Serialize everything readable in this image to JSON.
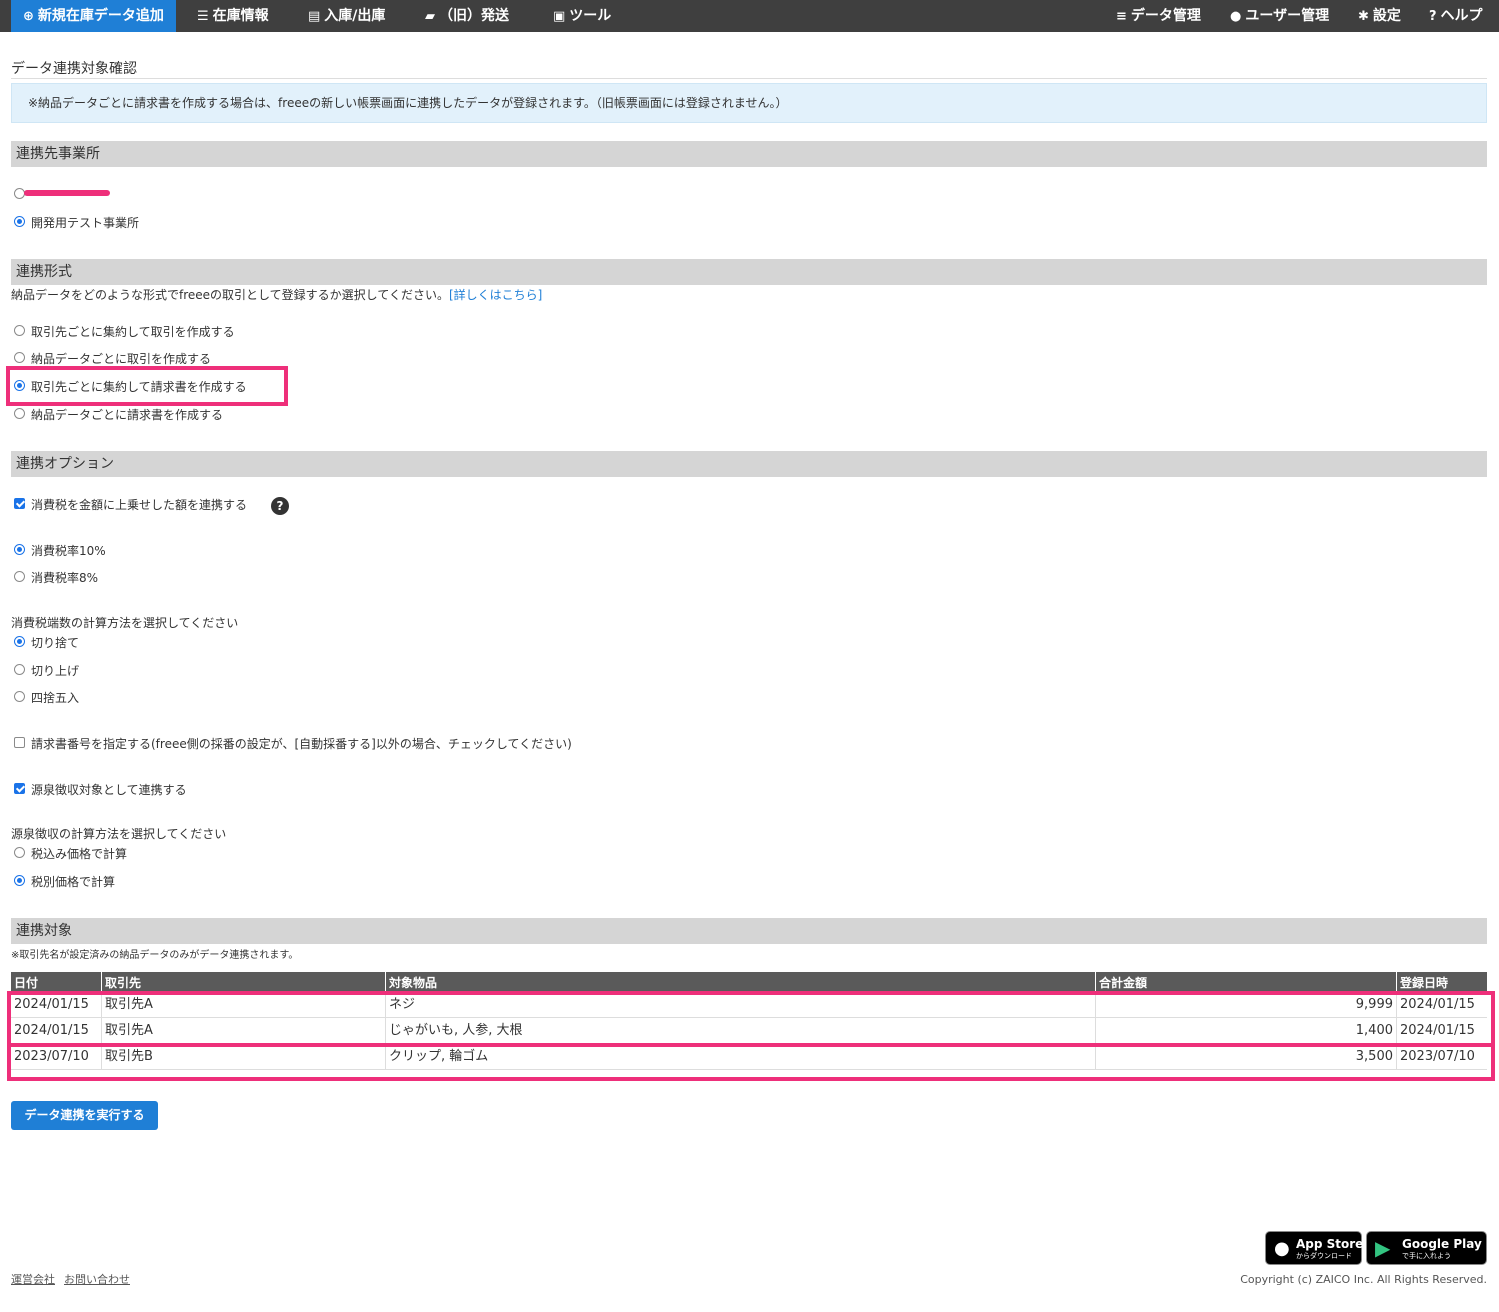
{
  "nav": {
    "primary": "新規在庫データ追加",
    "inventory": "在庫情報",
    "inout": "入庫/出庫",
    "shipping": "（旧）発送",
    "tools": "ツール",
    "data_management": "データ管理",
    "user_management": "ユーザー管理",
    "settings": "設定",
    "help": "ヘルプ"
  },
  "page": {
    "title": "データ連携対象確認",
    "notice": "※納品データごとに請求書を作成する場合は、freeeの新しい帳票画面に連携したデータが登録されます。（旧帳票画面には登録されません。）"
  },
  "office": {
    "heading": "連携先事業所",
    "options": [
      "",
      "開発用テスト事業所"
    ]
  },
  "format": {
    "heading": "連携形式",
    "description": "納品データをどのような形式でfreeeの取引として登録するか選択してください。",
    "detail_link": "[詳しくはこちら]",
    "options": [
      "取引先ごとに集約して取引を作成する",
      "納品データごとに取引を作成する",
      "取引先ごとに集約して請求書を作成する",
      "納品データごとに請求書を作成する"
    ]
  },
  "options": {
    "heading": "連携オプション",
    "tax_add": "消費税を金額に上乗せした額を連携する",
    "help_mark": "?",
    "tax_rates": [
      "消費税率10%",
      "消費税率8%"
    ],
    "rounding_label": "消費税端数の計算方法を選択してください",
    "rounding": [
      "切り捨て",
      "切り上げ",
      "四捨五入"
    ],
    "invoice_number": "請求書番号を指定する(freee側の採番の設定が、[自動採番する]以外の場合、チェックしてください)",
    "withholding": "源泉徴収対象として連携する",
    "withholding_label": "源泉徴収の計算方法を選択してください",
    "withholding_methods": [
      "税込み価格で計算",
      "税別価格で計算"
    ]
  },
  "targets": {
    "heading": "連携対象",
    "note": "※取引先名が設定済みの納品データのみがデータ連携されます。",
    "columns": [
      "日付",
      "取引先",
      "対象物品",
      "合計金額",
      "登録日時"
    ],
    "rows": [
      {
        "date": "2024/01/15",
        "partner": "取引先A",
        "items": "ネジ",
        "total": "9,999",
        "registered": "2024/01/15"
      },
      {
        "date": "2024/01/15",
        "partner": "取引先A",
        "items": "じゃがいも, 人参, 大根",
        "total": "1,400",
        "registered": "2024/01/15"
      },
      {
        "date": "2023/07/10",
        "partner": "取引先B",
        "items": "クリップ, 輪ゴム",
        "total": "3,500",
        "registered": "2023/07/10"
      }
    ]
  },
  "run_button": "データ連携を実行する",
  "footer": {
    "company": "運営会社",
    "contact": "お問い合わせ",
    "appstore": "App Store",
    "appstore_sub": "からダウンロード",
    "googleplay": "Google Play",
    "googleplay_sub": "で手に入れよう",
    "copyright": "Copyright (c) ZAICO Inc. All Rights Reserved."
  },
  "colors": {
    "nav_bg": "#3f3f3f",
    "primary": "#1f7fd6",
    "highlight": "#ee2f7a",
    "notice_bg": "#e2f1fb"
  }
}
